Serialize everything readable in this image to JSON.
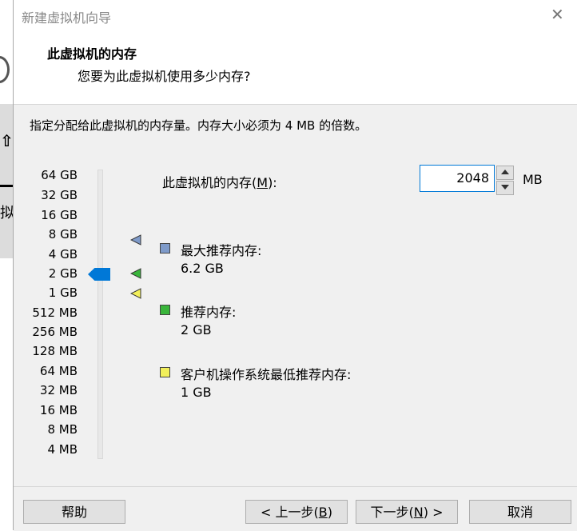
{
  "window": {
    "title": "新建虚拟机向导"
  },
  "header": {
    "title": "此虚拟机的内存",
    "subtitle": "您要为此虚拟机使用多少内存?"
  },
  "instruction": "指定分配给此虚拟机的内存量。内存大小必须为 4 MB 的倍数。",
  "scale_labels": [
    "64 GB",
    "32 GB",
    "16 GB",
    "8 GB",
    "4 GB",
    "2 GB",
    "1 GB",
    "512 MB",
    "256 MB",
    "128 MB",
    "64 MB",
    "32 MB",
    "16 MB",
    "8 MB",
    "4 MB"
  ],
  "memory": {
    "label_prefix": "此虚拟机的内存(",
    "label_key": "M",
    "label_suffix": "):",
    "value": "2048",
    "unit": "MB",
    "slider_value": "2 GB"
  },
  "legend": [
    {
      "label": "最大推荐内存:",
      "value": "6.2 GB",
      "color": "#7e9ac9"
    },
    {
      "label": "推荐内存:",
      "value": "2 GB",
      "color": "#39b53b"
    },
    {
      "label": "客户机操作系统最低推荐内存:",
      "value": "1 GB",
      "color": "#f2ef5a"
    }
  ],
  "buttons": {
    "help": "帮助",
    "back_prefix": "< 上一步(",
    "back_key": "B",
    "back_suffix": ")",
    "next_prefix": "下一步(",
    "next_key": "N",
    "next_suffix": ") >",
    "cancel": "取消"
  },
  "background": {
    "side_char": "拟"
  }
}
